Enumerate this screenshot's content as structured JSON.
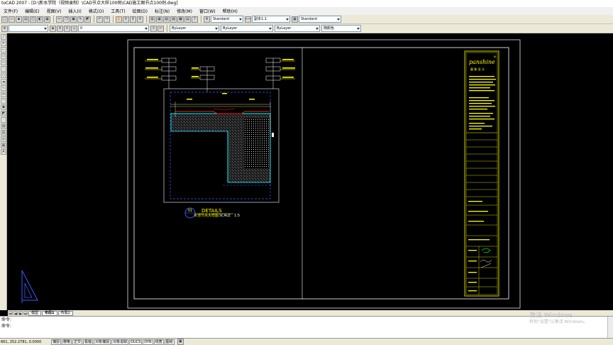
{
  "window": {
    "title": "toCAD 2007 - [D:\\新水学院（视频录制）\\CAD节点大样100例\\CAD施工图节点100例.dwg]"
  },
  "menu": [
    "文件(F)",
    "编辑(E)",
    "视图(V)",
    "插入(I)",
    "格式(O)",
    "工具(T)",
    "绘图(D)",
    "标注(N)",
    "修改(M)",
    "窗口(W)",
    "帮助(H)"
  ],
  "toolbar1": {
    "text_style": "Standard",
    "dim_style": "副本1:1",
    "table_style": "Standard"
  },
  "toolbar2": {
    "layer": "0",
    "color": "ByLayer",
    "linetype": "ByLayer",
    "lineweight": "ByLayer",
    "plotstyle": "随颜色"
  },
  "drawing": {
    "detail_number": "01",
    "detail_heading": "DETAILS",
    "detail_name": "水池节点大样图",
    "detail_scale": "SCALE　1:5",
    "brand": "panshine",
    "brand_cn": "磐 象 设 计",
    "colors": {
      "yellow": "#ffff00",
      "cyan": "#00ffff",
      "blue": "#3b5bff",
      "red": "#ff2020",
      "white": "#ffffff",
      "green": "#00ff00"
    }
  },
  "tabs": {
    "model": "模型",
    "layout1": "布局1",
    "layout2": "布局2"
  },
  "command": {
    "line1": "命令:",
    "line2": "命令:"
  },
  "status": {
    "coords": "661, 252.2781, 0.0000",
    "buttons": [
      "捕捉",
      "栅格",
      "正交",
      "极轴",
      "对象捕捉",
      "对象追踪",
      "DUCS",
      "DYN",
      "线宽",
      "图纸"
    ]
  },
  "watermark": {
    "title": "激活 Windows",
    "subtitle": "转到\"设置\"以激活 Windows。"
  }
}
